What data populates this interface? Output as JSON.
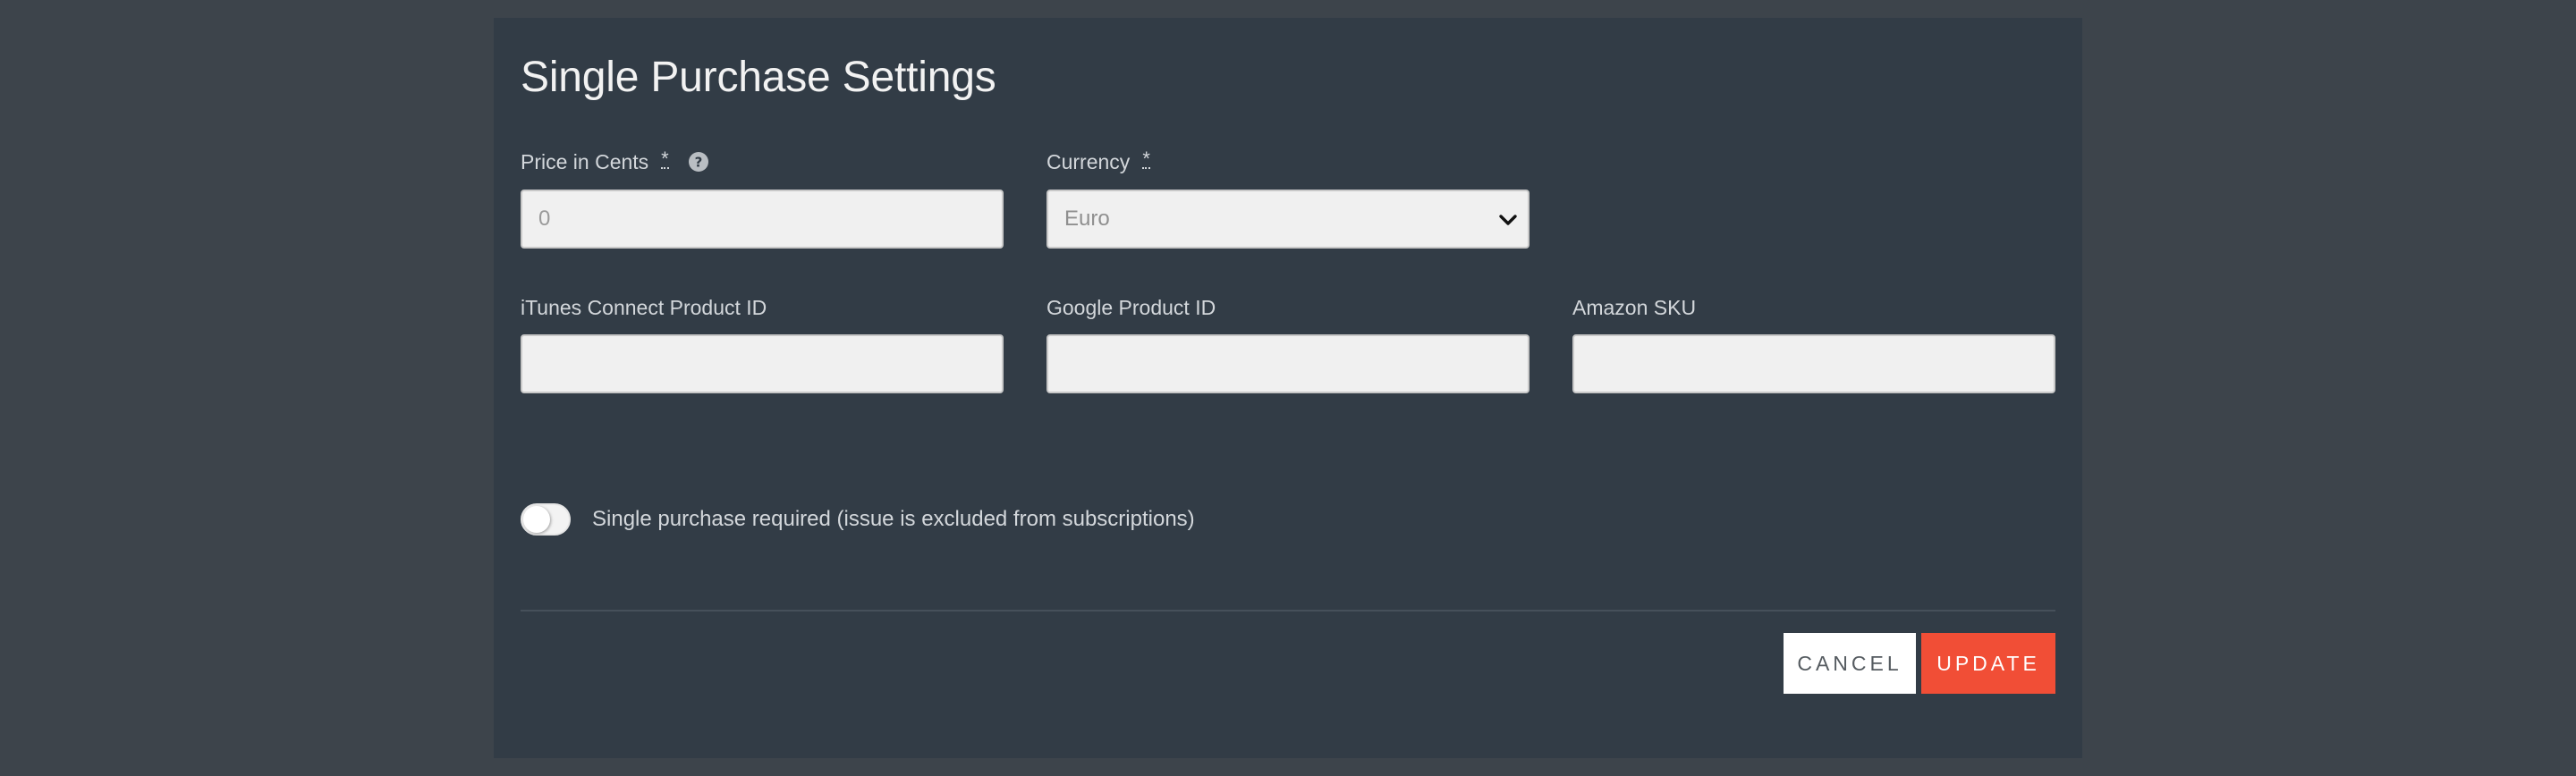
{
  "modal": {
    "title": "Single Purchase Settings"
  },
  "fields": {
    "price": {
      "label": "Price in Cents",
      "required_marker": "*",
      "placeholder": "0",
      "value": ""
    },
    "currency": {
      "label": "Currency",
      "required_marker": "*",
      "selected": "Euro"
    },
    "itunes": {
      "label": "iTunes Connect Product ID",
      "value": ""
    },
    "google": {
      "label": "Google Product ID",
      "value": ""
    },
    "amazon": {
      "label": "Amazon SKU",
      "value": ""
    }
  },
  "toggle": {
    "label": "Single purchase required (issue is excluded from subscriptions)",
    "on": false
  },
  "buttons": {
    "cancel": "CANCEL",
    "update": "UPDATE"
  },
  "colors": {
    "page_bg": "#3d444b",
    "modal_bg": "#323c46",
    "accent": "#f14e36",
    "input_bg": "#f0f0f0"
  },
  "icons": {
    "help": "question-circle",
    "select_chevron": "chevron-down"
  }
}
